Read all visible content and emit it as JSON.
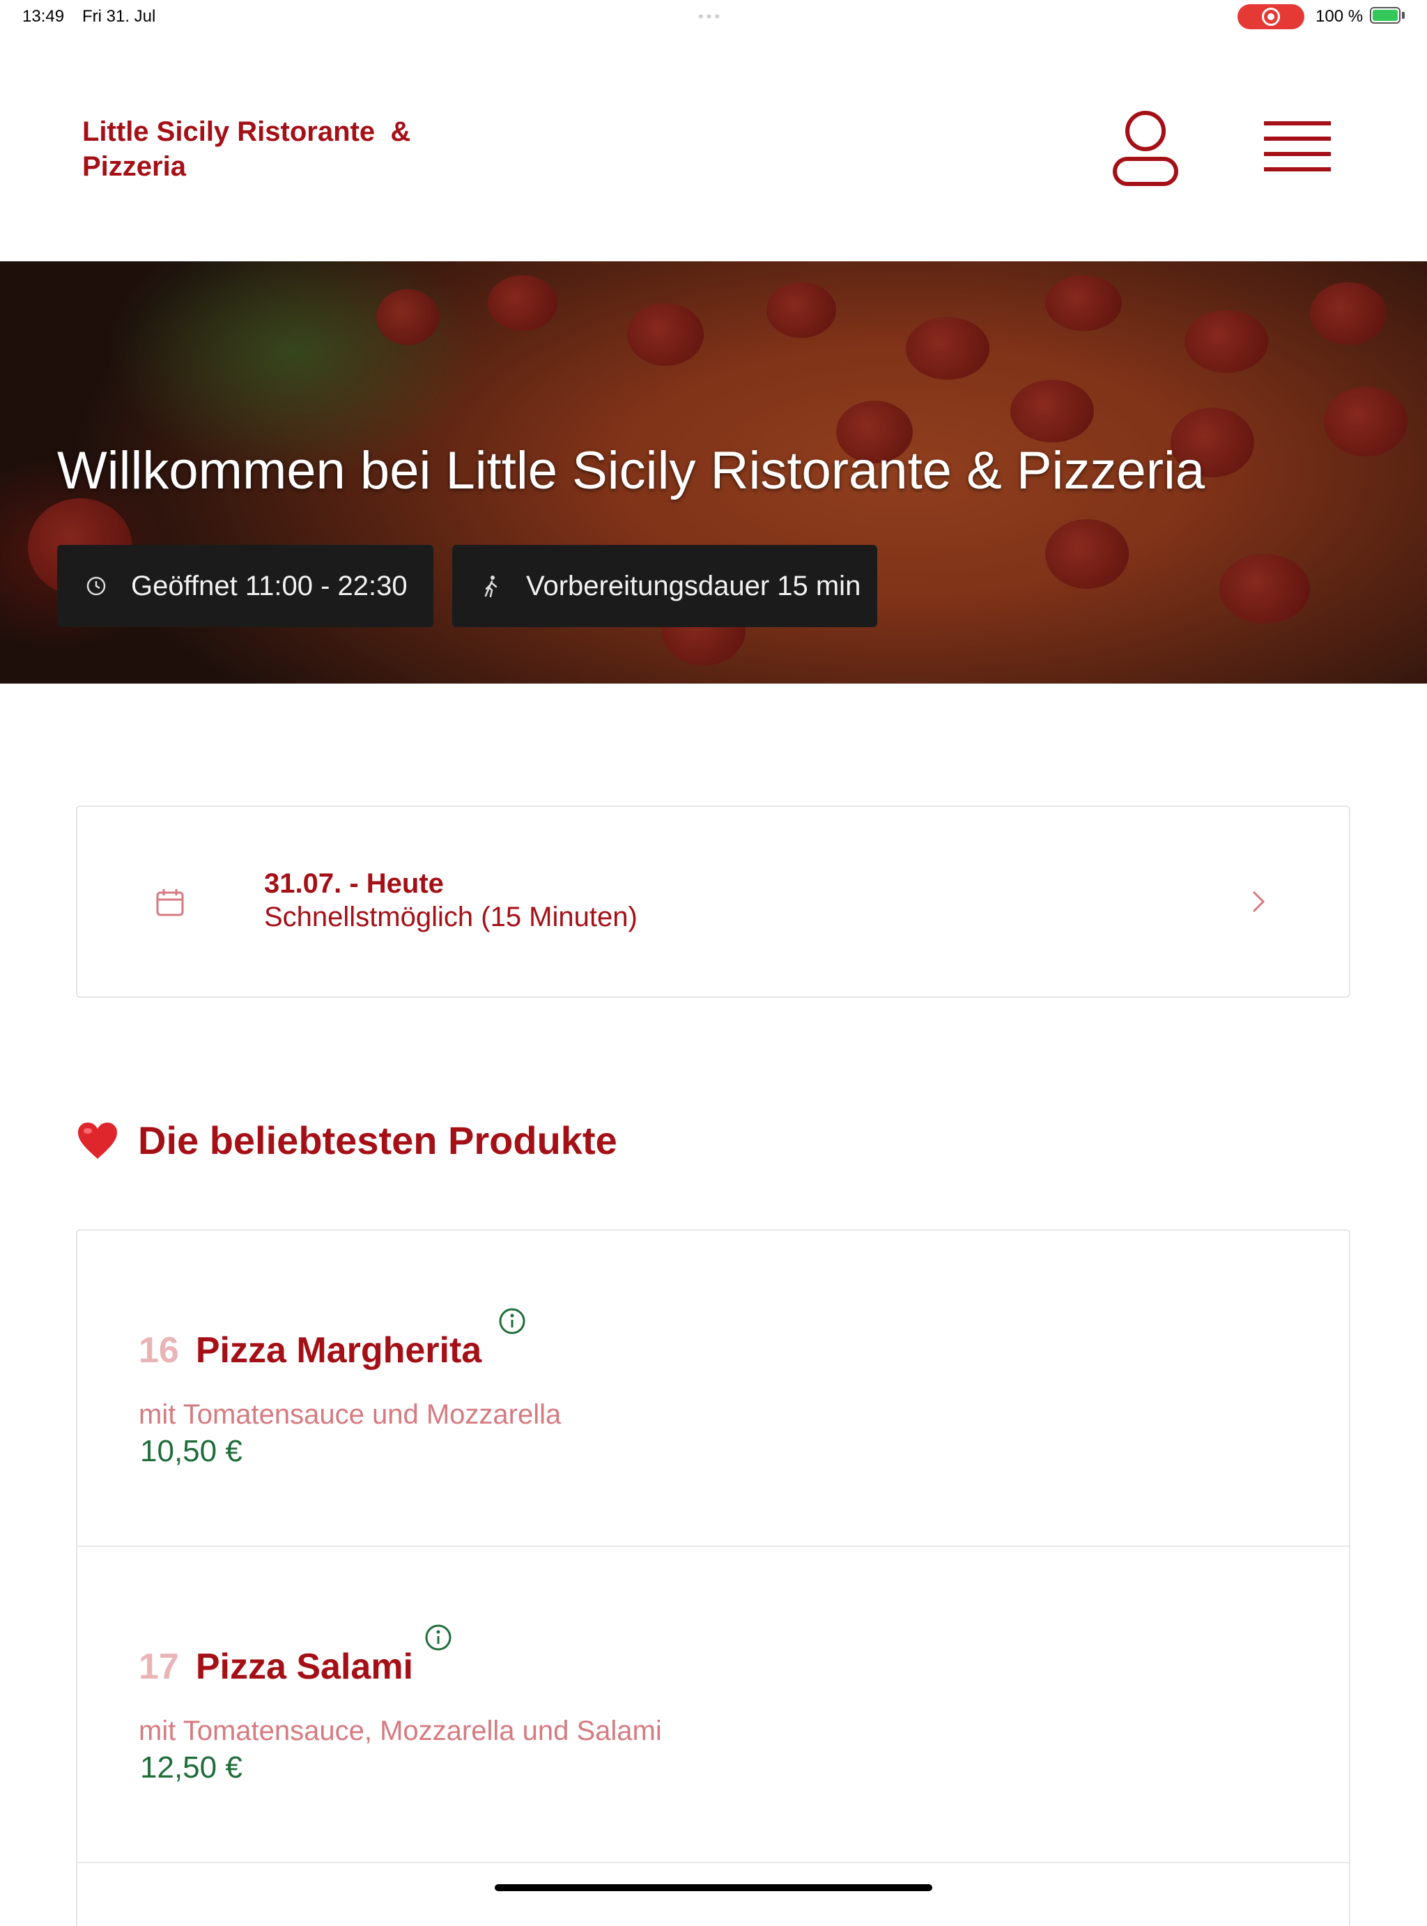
{
  "status_bar": {
    "time": "13:49",
    "date": "Fri 31. Jul",
    "battery": "100 %"
  },
  "header": {
    "brand": "Little Sicily Ristorante  &\nPizzeria"
  },
  "hero": {
    "title": "Willkommen bei Little Sicily Ristorante  & Pizzeria",
    "opening": "Geöffnet 11:00 - 22:30",
    "prep": "Vorbereitungsdauer 15 min"
  },
  "date_selector": {
    "title": "31.07. - Heute",
    "subtitle": "Schnellstmöglich (15 Minuten)"
  },
  "section": {
    "title": "Die beliebtesten Produkte"
  },
  "products": [
    {
      "number": "16",
      "name": "Pizza Margherita",
      "description": "mit Tomatensauce und Mozzarella",
      "price": "10,50 €"
    },
    {
      "number": "17",
      "name": "Pizza Salami",
      "description": "mit Tomatensauce, Mozzarella und Salami",
      "price": "12,50 €"
    }
  ],
  "colors": {
    "brand": "#a50f16",
    "price": "#1f6d3a",
    "muted_pink": "#d57a80"
  }
}
